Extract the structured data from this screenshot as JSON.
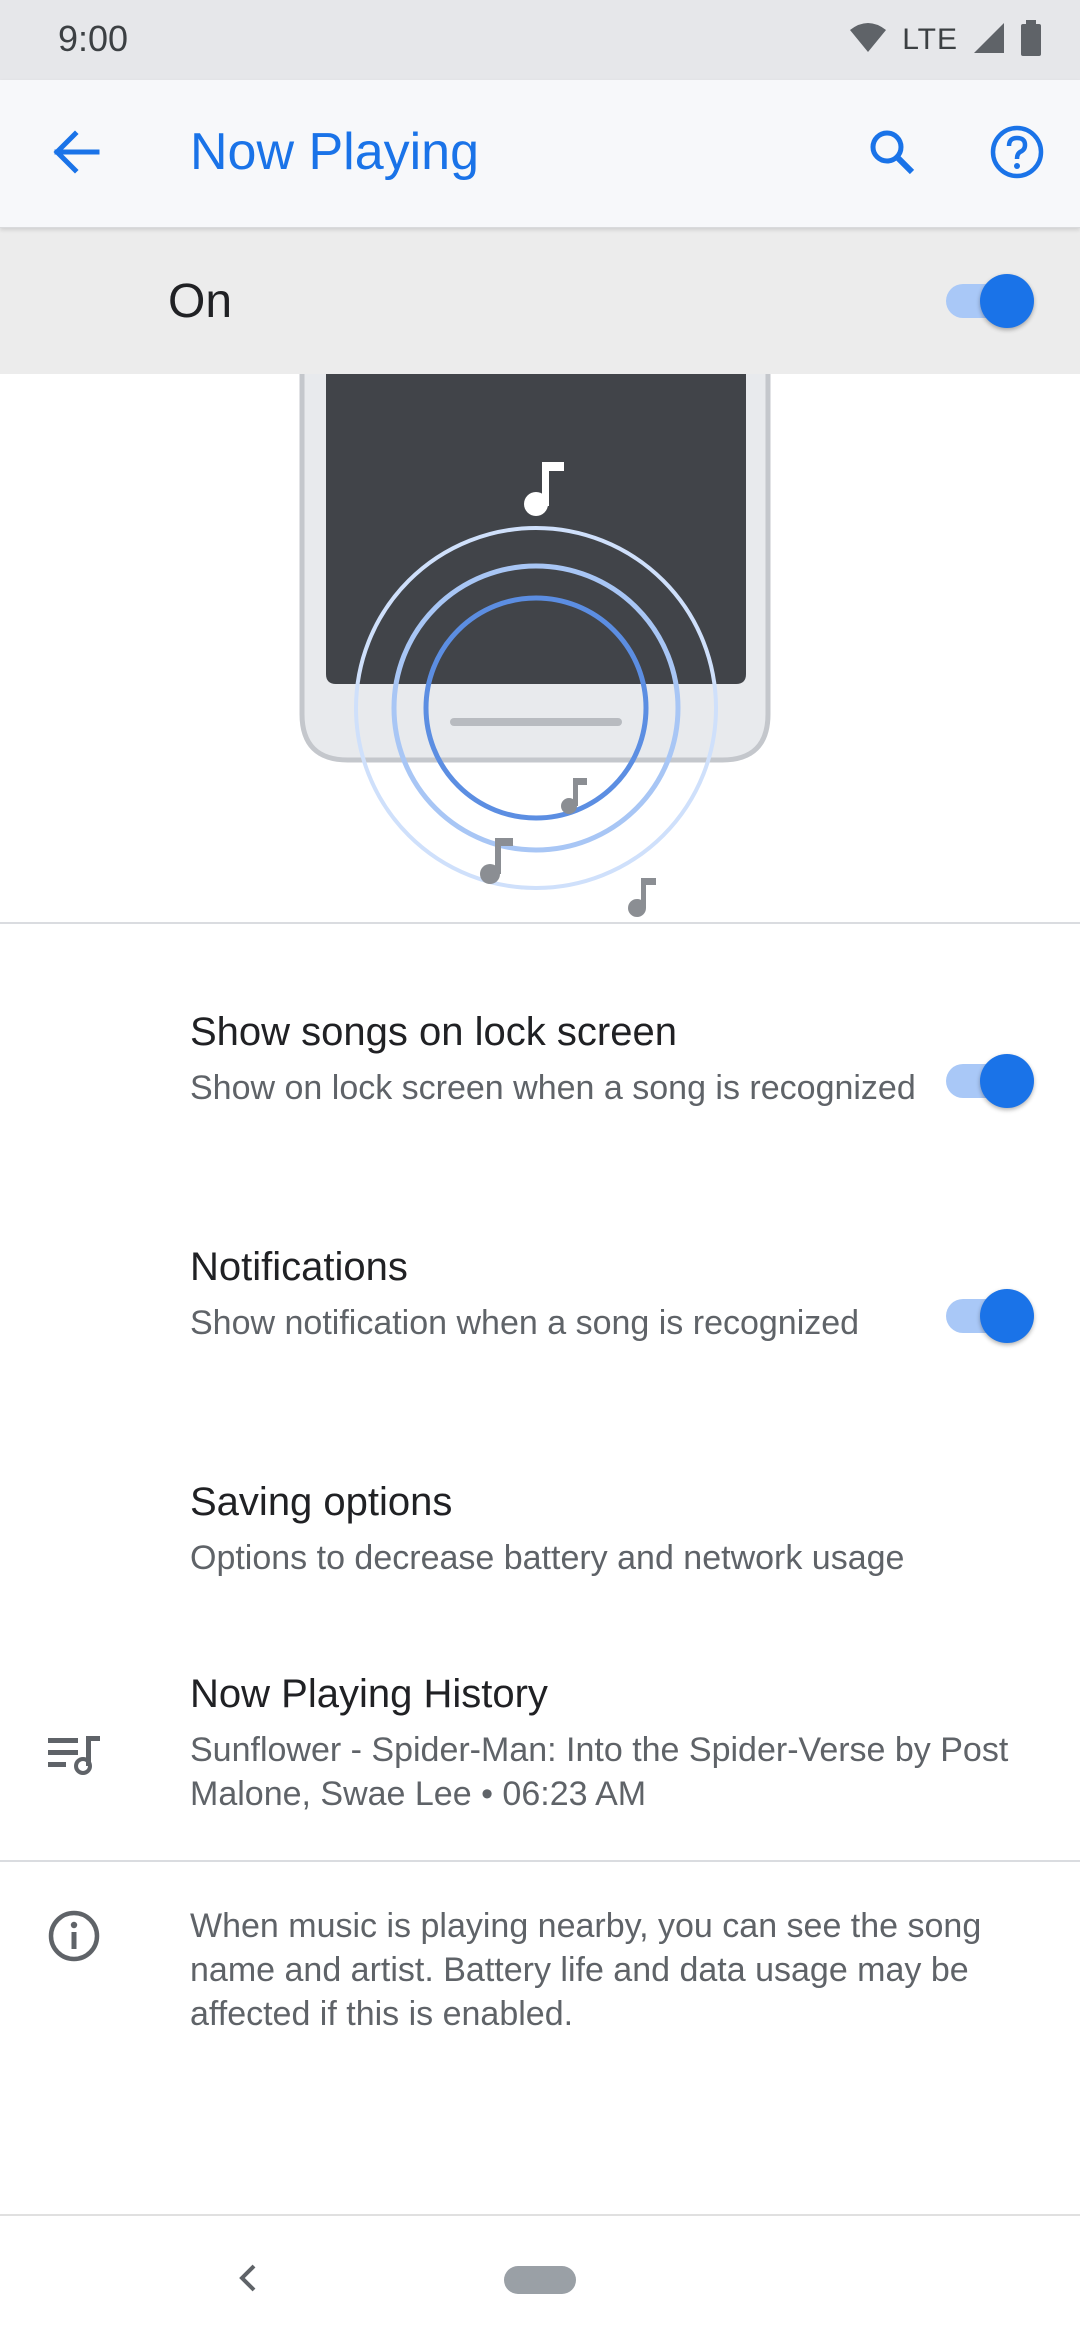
{
  "status_bar": {
    "time": "9:00",
    "network": "LTE"
  },
  "app_bar": {
    "title": "Now Playing"
  },
  "master_switch": {
    "label": "On",
    "checked": true
  },
  "preferences": [
    {
      "title": "Show songs on lock screen",
      "summary": "Show on lock screen when a song is recognized",
      "checked": true
    },
    {
      "title": "Notifications",
      "summary": "Show notification when a song is recognized",
      "checked": true
    },
    {
      "title": "Saving options",
      "summary": "Options to decrease battery and network usage"
    },
    {
      "title": "Now Playing History",
      "summary": "Sunflower - Spider-Man: Into the Spider-Verse by Post Malone, Swae Lee • 06:23 AM",
      "icon": "playlist-music-icon"
    }
  ],
  "footer": {
    "text": "When music is playing nearby, you can see the song name and artist. Battery life and data usage may be affected if this is enabled.",
    "icon": "info-icon"
  },
  "colors": {
    "accent": "#1a73e8",
    "switch_track": "#a9c8f7",
    "appbar_bg": "#f7f8fa",
    "master_bg": "#ececec"
  }
}
